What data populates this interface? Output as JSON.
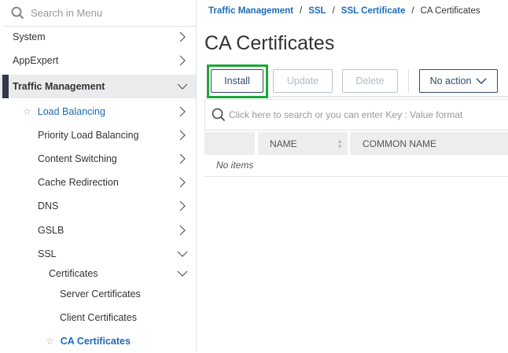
{
  "sidebar": {
    "search_placeholder": "Search in Menu",
    "items": [
      {
        "label": "System"
      },
      {
        "label": "AppExpert"
      },
      {
        "label": "Traffic Management"
      },
      {
        "label": "Load Balancing"
      },
      {
        "label": "Priority Load Balancing"
      },
      {
        "label": "Content Switching"
      },
      {
        "label": "Cache Redirection"
      },
      {
        "label": "DNS"
      },
      {
        "label": "GSLB"
      },
      {
        "label": "SSL"
      },
      {
        "label": "Certificates"
      },
      {
        "label": "Server Certificates"
      },
      {
        "label": "Client Certificates"
      },
      {
        "label": "CA Certificates"
      }
    ]
  },
  "breadcrumb": [
    "Traffic Management",
    "SSL",
    "SSL Certificate",
    "CA Certificates"
  ],
  "page_title": "CA Certificates",
  "toolbar": {
    "install": "Install",
    "update": "Update",
    "delete": "Delete",
    "action": "No action"
  },
  "search": {
    "placeholder": "Click here to search or you can enter Key : Value format"
  },
  "table": {
    "columns": [
      "NAME",
      "COMMON NAME"
    ],
    "empty": "No items"
  },
  "colors": {
    "link": "#1c6bb8",
    "highlight": "#1aa837",
    "primary": "#2f4a6d"
  }
}
